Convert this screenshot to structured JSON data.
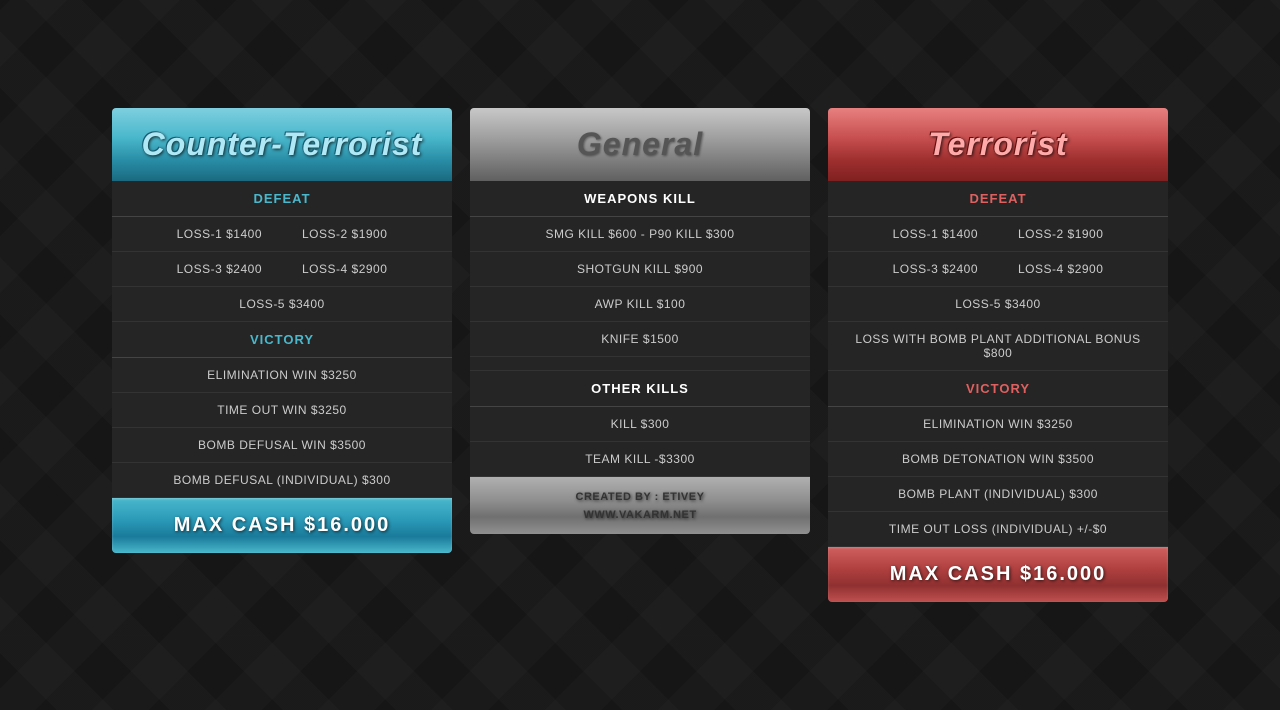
{
  "ct": {
    "title": "Counter-Terrorist",
    "defeat_label": "DEFEAT",
    "loss1": "LOSS-1 $1400",
    "loss2": "LOSS-2 $1900",
    "loss3": "LOSS-3 $2400",
    "loss4": "LOSS-4 $2900",
    "loss5": "LOSS-5 $3400",
    "victory_label": "VICTORY",
    "row1": "ELIMINATION WIN $3250",
    "row2": "TIME OUT WIN $3250",
    "row3": "BOMB DEFUSAL WIN $3500",
    "row4": "BOMB DEFUSAL (INDIVIDUAL) $300",
    "footer": "MAX CASH $16.000"
  },
  "general": {
    "title": "General",
    "weapons_kill_label": "WEAPONS KILL",
    "smg_kill": "SMG KILL $600 - P90 KILL $300",
    "shotgun_kill": "SHOTGUN KILL $900",
    "awp_kill": "AWP KILL $100",
    "knife": "KNIFE $1500",
    "other_kills_label": "OTHER KILLS",
    "kill": "KILL $300",
    "team_kill": "TEAM KILL -$3300",
    "footer_line1": "CREATED BY : ETIVEY",
    "footer_line2": "WWW.VAKARM.NET"
  },
  "t": {
    "title": "Terrorist",
    "defeat_label": "DEFEAT",
    "loss1": "LOSS-1 $1400",
    "loss2": "LOSS-2 $1900",
    "loss3": "LOSS-3 $2400",
    "loss4": "LOSS-4 $2900",
    "loss5": "LOSS-5 $3400",
    "bomb_bonus": "LOSS WITH BOMB PLANT ADDITIONAL BONUS $800",
    "victory_label": "VICTORY",
    "row1": "ELIMINATION WIN $3250",
    "row2": "BOMB DETONATION WIN $3500",
    "row3": "BOMB PLANT (INDIVIDUAL) $300",
    "row4": "TIME OUT LOSS (INDIVIDUAL) +/-$0",
    "footer": "MAX CASH $16.000"
  }
}
